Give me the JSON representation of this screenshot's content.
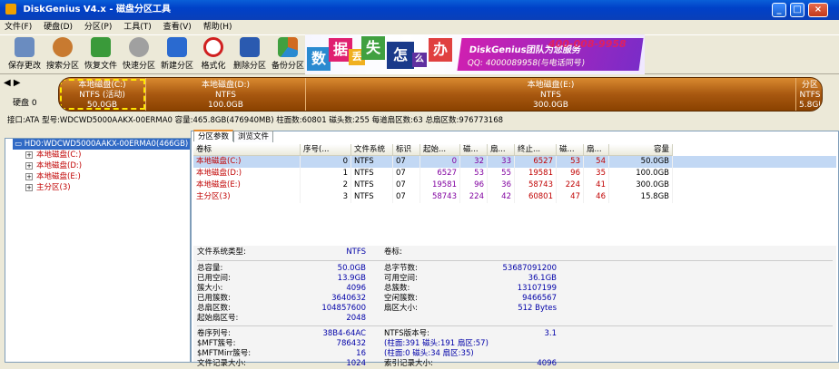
{
  "window": {
    "title": "DiskGenius V4.x - 磁盘分区工具"
  },
  "menu": [
    "文件(F)",
    "硬盘(D)",
    "分区(P)",
    "工具(T)",
    "查看(V)",
    "帮助(H)"
  ],
  "toolbar": [
    {
      "label": "保存更改",
      "icon": "save-icon",
      "color": "#6a8cc0"
    },
    {
      "label": "搜索分区",
      "icon": "search-icon",
      "color": "#c87a30"
    },
    {
      "label": "恢复文件",
      "icon": "recover-icon",
      "color": "#3a9a3a"
    },
    {
      "label": "快速分区",
      "icon": "quick-partition-icon",
      "color": "#8a8a8a"
    },
    {
      "label": "新建分区",
      "icon": "new-partition-icon",
      "color": "#2a6ad0"
    },
    {
      "label": "格式化",
      "icon": "format-icon",
      "color": "#d02020"
    },
    {
      "label": "删除分区",
      "icon": "delete-partition-icon",
      "color": "#2a5ab0"
    },
    {
      "label": "备份分区",
      "icon": "backup-partition-icon",
      "color": "#d06a20"
    }
  ],
  "banner": {
    "chars": [
      {
        "c": "数",
        "bg": "#2a8ad0"
      },
      {
        "c": "据",
        "bg": "#e02070"
      },
      {
        "c": "丢",
        "bg": "#f0b020"
      },
      {
        "c": "失",
        "bg": "#40a040"
      },
      {
        "c": "怎",
        "bg": "#1a3a8a"
      },
      {
        "c": "么",
        "bg": "#6030a0"
      },
      {
        "c": "办",
        "bg": "#e04040"
      }
    ],
    "brand": "DiskGenius团队为您服务",
    "phone": "400-008-9958",
    "qq": "QQ: 4000089958(与电话同号)"
  },
  "disk_nav": {
    "label": "硬盘 0"
  },
  "partitions_bar": [
    {
      "name": "本地磁盘(C:)",
      "fs": "NTFS (活动)",
      "size": "50.0GB",
      "selected": true
    },
    {
      "name": "本地磁盘(D:)",
      "fs": "NTFS",
      "size": "100.0GB",
      "selected": false
    },
    {
      "name": "本地磁盘(E:)",
      "fs": "NTFS",
      "size": "300.0GB",
      "selected": false
    },
    {
      "name": "分区",
      "fs": "NTFS",
      "size": "5.8GI",
      "selected": false
    }
  ],
  "disk_info": "接口:ATA  型号:WDCWD5000AAKX-00ERMA0  容量:465.8GB(476940MB)  柱面数:60801  磁头数:255  每道扇区数:63  总扇区数:976773168",
  "tree": {
    "root": "HD0:WDCWD5000AAKX-00ERMA0(466GB)",
    "children": [
      "本地磁盘(C:)",
      "本地磁盘(D:)",
      "本地磁盘(E:)",
      "主分区(3)"
    ]
  },
  "tabs": [
    "分区参数",
    "浏览文件"
  ],
  "table": {
    "headers": [
      "卷标",
      "序号(...",
      "文件系统",
      "标识",
      "起始...",
      "磁...",
      "扇...",
      "终止...",
      "磁...",
      "扇...",
      "容量"
    ],
    "rows": [
      [
        "本地磁盘(C:)",
        "0",
        "NTFS",
        "07",
        "0",
        "32",
        "33",
        "6527",
        "53",
        "54",
        "50.0GB"
      ],
      [
        "本地磁盘(D:)",
        "1",
        "NTFS",
        "07",
        "6527",
        "53",
        "55",
        "19581",
        "96",
        "35",
        "100.0GB"
      ],
      [
        "本地磁盘(E:)",
        "2",
        "NTFS",
        "07",
        "19581",
        "96",
        "36",
        "58743",
        "224",
        "41",
        "300.0GB"
      ],
      [
        "主分区(3)",
        "3",
        "NTFS",
        "07",
        "58743",
        "224",
        "42",
        "60801",
        "47",
        "46",
        "15.8GB"
      ]
    ]
  },
  "detail": {
    "fs_type_label": "文件系统类型:",
    "fs_type_value": "NTFS",
    "vol_label": "卷标:",
    "left": [
      [
        "总容量:",
        "50.0GB"
      ],
      [
        "已用空间:",
        "13.9GB"
      ],
      [
        "簇大小:",
        "4096"
      ],
      [
        "已用簇数:",
        "3640632"
      ],
      [
        "总扇区数:",
        "104857600"
      ],
      [
        "起始扇区号:",
        "2048"
      ]
    ],
    "right": [
      [
        "总字节数:",
        "53687091200"
      ],
      [
        "可用空间:",
        "36.1GB"
      ],
      [
        "总簇数:",
        "13107199"
      ],
      [
        "空闲簇数:",
        "9466567"
      ],
      [
        "扇区大小:",
        "512 Bytes"
      ]
    ],
    "left2": [
      [
        "卷序列号:",
        "38B4-64AC"
      ],
      [
        "$MFT簇号:",
        "786432"
      ],
      [
        "$MFTMirr簇号:",
        "16"
      ],
      [
        "文件记录大小:",
        "1024"
      ]
    ],
    "right2": [
      [
        "NTFS版本号:",
        "3.1"
      ],
      [
        "(柱面:391 磁头:191 扇区:57)",
        ""
      ],
      [
        "(柱面:0 磁头:34 扇区:35)",
        ""
      ],
      [
        "索引记录大小:",
        "4096"
      ]
    ]
  }
}
